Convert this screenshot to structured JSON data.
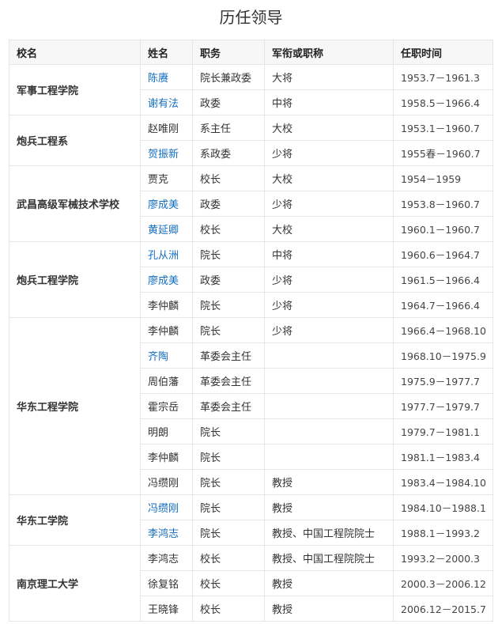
{
  "title": "历任领导",
  "headers": [
    "校名",
    "姓名",
    "职务",
    "军衔或职称",
    "任职时间"
  ],
  "colors": {
    "link": "#136ec2",
    "header_bg": "#f7f7f7",
    "border": "#e6e6e6"
  },
  "groups": [
    {
      "school": "军事工程学院",
      "rows": [
        {
          "name": "陈赓",
          "link": true,
          "post": "院长兼政委",
          "rank": "大将",
          "period": "1953.7－1961.3"
        },
        {
          "name": "谢有法",
          "link": true,
          "post": "政委",
          "rank": "中将",
          "period": "1958.5－1966.4"
        }
      ]
    },
    {
      "school": "炮兵工程系",
      "rows": [
        {
          "name": "赵唯刚",
          "link": false,
          "post": "系主任",
          "rank": "大校",
          "period": "1953.1－1960.7"
        },
        {
          "name": "贺振新",
          "link": true,
          "post": "系政委",
          "rank": "少将",
          "period": "1955春－1960.7"
        }
      ]
    },
    {
      "school": "武昌高级军械技术学校",
      "rows": [
        {
          "name": "贾克",
          "link": false,
          "post": "校长",
          "rank": "大校",
          "period": "1954－1959"
        },
        {
          "name": "廖成美",
          "link": true,
          "post": "政委",
          "rank": "少将",
          "period": "1953.8－1960.7"
        },
        {
          "name": "黄延卿",
          "link": true,
          "post": "校长",
          "rank": "大校",
          "period": "1960.1－1960.7"
        }
      ]
    },
    {
      "school": "炮兵工程学院",
      "rows": [
        {
          "name": "孔从洲",
          "link": true,
          "post": "院长",
          "rank": "中将",
          "period": "1960.6－1964.7"
        },
        {
          "name": "廖成美",
          "link": true,
          "post": "政委",
          "rank": "少将",
          "period": "1961.5－1966.4"
        },
        {
          "name": "李仲麟",
          "link": false,
          "post": "院长",
          "rank": "少将",
          "period": "1964.7－1966.4"
        }
      ]
    },
    {
      "school": "华东工程学院",
      "rows": [
        {
          "name": "李仲麟",
          "link": false,
          "post": "院长",
          "rank": "少将",
          "period": "1966.4－1968.10"
        },
        {
          "name": "齐陶",
          "link": true,
          "post": "革委会主任",
          "rank": "",
          "period": "1968.10－1975.9"
        },
        {
          "name": "周伯藩",
          "link": false,
          "post": "革委会主任",
          "rank": "",
          "period": "1975.9－1977.7"
        },
        {
          "name": "霍宗岳",
          "link": false,
          "post": "革委会主任",
          "rank": "",
          "period": "1977.7－1979.7"
        },
        {
          "name": "明朗",
          "link": false,
          "post": "院长",
          "rank": "",
          "period": "1979.7－1981.1"
        },
        {
          "name": "李仲麟",
          "link": false,
          "post": "院长",
          "rank": "",
          "period": "1981.1－1983.4"
        },
        {
          "name": "冯缵刚",
          "link": false,
          "post": "院长",
          "rank": "教授",
          "period": "1983.4－1984.10"
        }
      ]
    },
    {
      "school": "华东工学院",
      "rows": [
        {
          "name": "冯缵刚",
          "link": true,
          "post": "院长",
          "rank": "教授",
          "period": "1984.10－1988.1"
        },
        {
          "name": "李鸿志",
          "link": true,
          "post": "院长",
          "rank": "教授、中国工程院院士",
          "period": "1988.1－1993.2"
        }
      ]
    },
    {
      "school": "南京理工大学",
      "rows": [
        {
          "name": "李鸿志",
          "link": false,
          "post": "校长",
          "rank": "教授、中国工程院院士",
          "period": "1993.2－2000.3"
        },
        {
          "name": "徐复铭",
          "link": false,
          "post": "校长",
          "rank": "教授",
          "period": "2000.3－2006.12"
        },
        {
          "name": "王晓锋",
          "link": false,
          "post": "校长",
          "rank": "教授",
          "period": "2006.12－2015.7"
        }
      ]
    }
  ]
}
